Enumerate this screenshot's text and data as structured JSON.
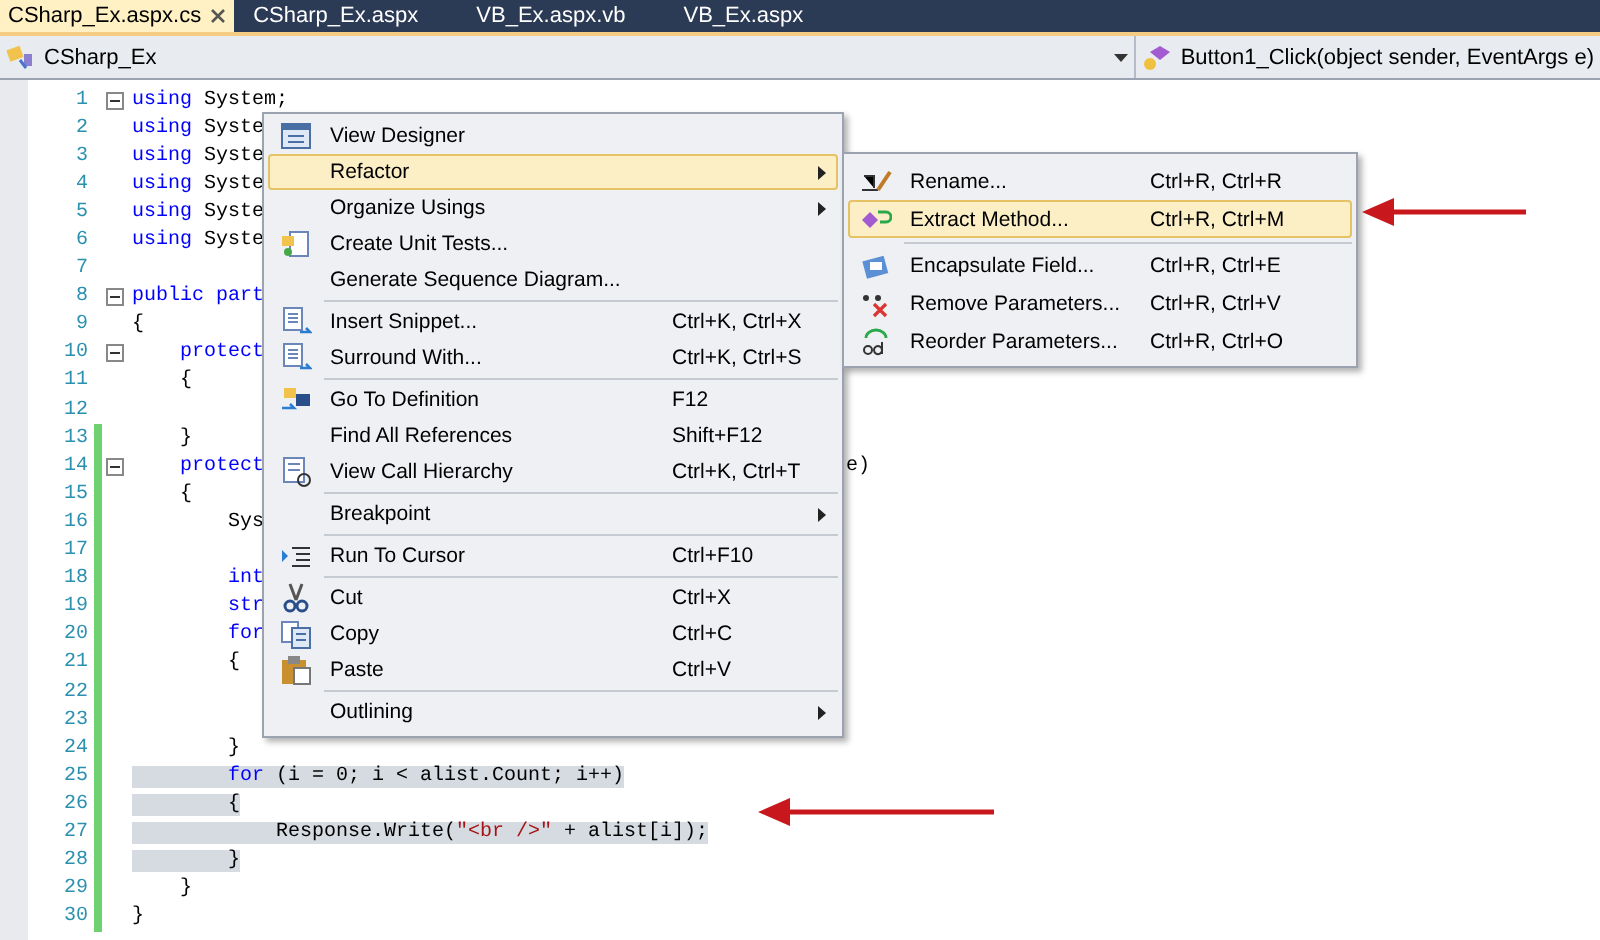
{
  "tabs": [
    {
      "label": "CSharp_Ex.aspx.cs",
      "selected": true
    },
    {
      "label": "CSharp_Ex.aspx",
      "selected": false
    },
    {
      "label": "VB_Ex.aspx.vb",
      "selected": false
    },
    {
      "label": "VB_Ex.aspx",
      "selected": false
    }
  ],
  "navigation": {
    "type_selector": "CSharp_Ex",
    "member_selector": "Button1_Click(object sender, EventArgs e)"
  },
  "code_lines": [
    {
      "number": "1",
      "changed": false,
      "fold": true,
      "selected": false,
      "segments": [
        {
          "kind": "keyword",
          "text": "using"
        },
        {
          "kind": "plain",
          "text": " System;"
        }
      ]
    },
    {
      "number": "2",
      "changed": false,
      "fold": false,
      "selected": false,
      "segments": [
        {
          "kind": "keyword",
          "text": "using"
        },
        {
          "kind": "plain",
          "text": " Syste"
        }
      ]
    },
    {
      "number": "3",
      "changed": false,
      "fold": false,
      "selected": false,
      "segments": [
        {
          "kind": "keyword",
          "text": "using"
        },
        {
          "kind": "plain",
          "text": " Syste"
        }
      ]
    },
    {
      "number": "4",
      "changed": false,
      "fold": false,
      "selected": false,
      "segments": [
        {
          "kind": "keyword",
          "text": "using"
        },
        {
          "kind": "plain",
          "text": " Syste"
        }
      ]
    },
    {
      "number": "5",
      "changed": false,
      "fold": false,
      "selected": false,
      "segments": [
        {
          "kind": "keyword",
          "text": "using"
        },
        {
          "kind": "plain",
          "text": " Syste"
        }
      ]
    },
    {
      "number": "6",
      "changed": false,
      "fold": false,
      "selected": false,
      "segments": [
        {
          "kind": "keyword",
          "text": "using"
        },
        {
          "kind": "plain",
          "text": " Syste"
        }
      ]
    },
    {
      "number": "7",
      "changed": false,
      "fold": false,
      "selected": false
    },
    {
      "number": "8",
      "changed": false,
      "fold": true,
      "selected": false,
      "segments": [
        {
          "kind": "keyword",
          "text": "public part"
        }
      ]
    },
    {
      "number": "9",
      "changed": false,
      "fold": false,
      "selected": false,
      "segments": [
        {
          "kind": "plain",
          "text": "{"
        }
      ]
    },
    {
      "number": "10",
      "changed": false,
      "fold": true,
      "selected": false,
      "segments": [
        {
          "kind": "keyword",
          "text": "    protect"
        }
      ]
    },
    {
      "number": "11",
      "changed": false,
      "fold": false,
      "selected": false,
      "segments": [
        {
          "kind": "plain",
          "text": "    {"
        }
      ]
    },
    {
      "number": "12",
      "changed": false,
      "fold": false,
      "selected": false
    },
    {
      "number": "13",
      "changed": true,
      "fold": false,
      "selected": false,
      "segments": [
        {
          "kind": "plain",
          "text": "    }"
        }
      ]
    },
    {
      "number": "14",
      "changed": true,
      "fold": true,
      "selected": false,
      "segments": [
        {
          "kind": "keyword",
          "text": "    protect"
        }
      ],
      "tail": "e)"
    },
    {
      "number": "15",
      "changed": true,
      "fold": false,
      "selected": false,
      "segments": [
        {
          "kind": "plain",
          "text": "    {"
        }
      ]
    },
    {
      "number": "16",
      "changed": true,
      "fold": false,
      "selected": false,
      "segments": [
        {
          "kind": "plain",
          "text": "        Sys"
        }
      ]
    },
    {
      "number": "17",
      "changed": true,
      "fold": false,
      "selected": false
    },
    {
      "number": "18",
      "changed": true,
      "fold": false,
      "selected": false,
      "segments": [
        {
          "kind": "keyword",
          "text": "        int"
        }
      ]
    },
    {
      "number": "19",
      "changed": true,
      "fold": false,
      "selected": false,
      "segments": [
        {
          "kind": "keyword",
          "text": "        str"
        }
      ]
    },
    {
      "number": "20",
      "changed": true,
      "fold": false,
      "selected": false,
      "segments": [
        {
          "kind": "keyword",
          "text": "        for"
        }
      ]
    },
    {
      "number": "21",
      "changed": true,
      "fold": false,
      "selected": false,
      "segments": [
        {
          "kind": "plain",
          "text": "        {"
        }
      ]
    },
    {
      "number": "22",
      "changed": true,
      "fold": false,
      "selected": false
    },
    {
      "number": "23",
      "changed": true,
      "fold": false,
      "selected": false
    },
    {
      "number": "24",
      "changed": true,
      "fold": false,
      "selected": false,
      "segments": [
        {
          "kind": "plain",
          "text": "        }"
        }
      ]
    },
    {
      "number": "25",
      "changed": true,
      "fold": false,
      "selected": true,
      "segments": [
        {
          "kind": "keyword",
          "text": "        for"
        },
        {
          "kind": "plain",
          "text": " (i = 0; i < alist.Count; i++)"
        }
      ]
    },
    {
      "number": "26",
      "changed": true,
      "fold": false,
      "selected": true,
      "segments": [
        {
          "kind": "plain",
          "text": "        {"
        }
      ]
    },
    {
      "number": "27",
      "changed": true,
      "fold": false,
      "selected": true,
      "segments": [
        {
          "kind": "plain",
          "text": "            Response.Write("
        },
        {
          "kind": "string",
          "text": "\"<br />\""
        },
        {
          "kind": "plain",
          "text": " + alist[i]);"
        }
      ]
    },
    {
      "number": "28",
      "changed": true,
      "fold": false,
      "selected": true,
      "segments": [
        {
          "kind": "plain",
          "text": "        }"
        }
      ]
    },
    {
      "number": "29",
      "changed": true,
      "fold": false,
      "selected": false,
      "segments": [
        {
          "kind": "plain",
          "text": "    }"
        }
      ]
    },
    {
      "number": "30",
      "changed": true,
      "fold": false,
      "selected": false,
      "segments": [
        {
          "kind": "plain",
          "text": "}"
        }
      ]
    }
  ],
  "context_menu": [
    {
      "kind": "item",
      "label": "View Designer",
      "selected": false
    },
    {
      "kind": "item",
      "label": "Refactor",
      "selected": true,
      "submenu": true
    },
    {
      "kind": "item",
      "label": "Organize Usings",
      "selected": false,
      "submenu": true
    },
    {
      "kind": "item",
      "label": "Create Unit Tests...",
      "selected": false
    },
    {
      "kind": "item",
      "label": "Generate Sequence Diagram...",
      "selected": false
    },
    {
      "kind": "separator"
    },
    {
      "kind": "item",
      "label": "Insert Snippet...",
      "shortcut": "Ctrl+K, Ctrl+X",
      "selected": false
    },
    {
      "kind": "item",
      "label": "Surround With...",
      "shortcut": "Ctrl+K, Ctrl+S",
      "selected": false
    },
    {
      "kind": "separator"
    },
    {
      "kind": "item",
      "label": "Go To Definition",
      "shortcut": "F12",
      "selected": false
    },
    {
      "kind": "item",
      "label": "Find All References",
      "shortcut": "Shift+F12",
      "selected": false
    },
    {
      "kind": "item",
      "label": "View Call Hierarchy",
      "shortcut": "Ctrl+K, Ctrl+T",
      "selected": false
    },
    {
      "kind": "separator"
    },
    {
      "kind": "item",
      "label": "Breakpoint",
      "selected": false,
      "submenu": true
    },
    {
      "kind": "separator"
    },
    {
      "kind": "item",
      "label": "Run To Cursor",
      "shortcut": "Ctrl+F10",
      "selected": false
    },
    {
      "kind": "separator"
    },
    {
      "kind": "item",
      "label": "Cut",
      "shortcut": "Ctrl+X",
      "selected": false
    },
    {
      "kind": "item",
      "label": "Copy",
      "shortcut": "Ctrl+C",
      "selected": false
    },
    {
      "kind": "item",
      "label": "Paste",
      "shortcut": "Ctrl+V",
      "selected": false
    },
    {
      "kind": "separator"
    },
    {
      "kind": "item",
      "label": "Outlining",
      "selected": false,
      "submenu": true
    }
  ],
  "refactor_submenu": [
    {
      "kind": "item",
      "label": "Rename...",
      "shortcut": "Ctrl+R, Ctrl+R",
      "selected": false
    },
    {
      "kind": "item",
      "label": "Extract Method...",
      "shortcut": "Ctrl+R, Ctrl+M",
      "selected": true
    },
    {
      "kind": "separator"
    },
    {
      "kind": "item",
      "label": "Encapsulate Field...",
      "shortcut": "Ctrl+R, Ctrl+E",
      "selected": false
    },
    {
      "kind": "item",
      "label": "Remove Parameters...",
      "shortcut": "Ctrl+R, Ctrl+V",
      "selected": false
    },
    {
      "kind": "item",
      "label": "Reorder Parameters...",
      "shortcut": "Ctrl+R, Ctrl+O",
      "selected": false
    }
  ]
}
